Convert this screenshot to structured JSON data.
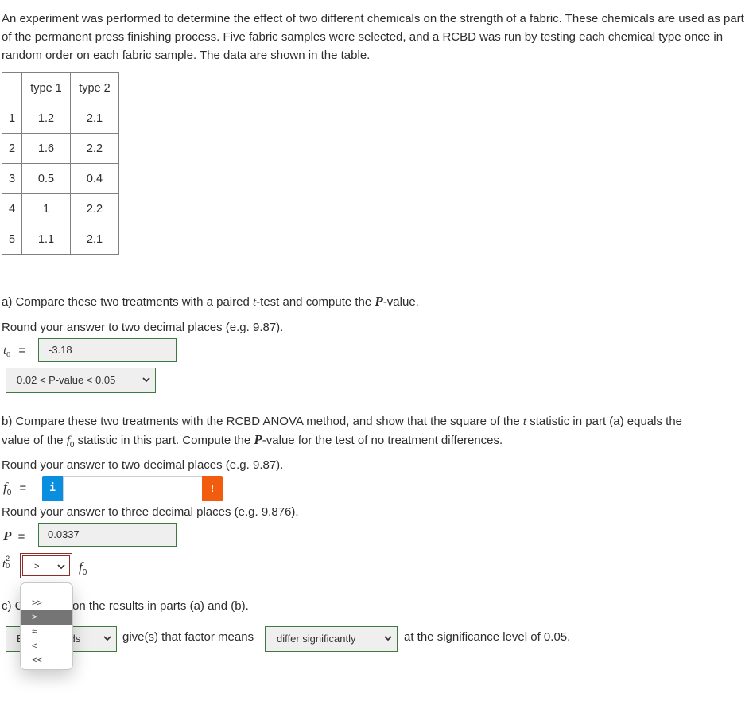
{
  "intro": "An experiment was performed to determine the effect of two different chemicals on the strength of a fabric. These chemicals are used as part of the permanent press finishing process. Five fabric samples were selected, and a RCBD was run by testing each chemical type once in random order on each fabric sample. The data are shown in the table.",
  "table": {
    "headers": [
      "",
      "type 1",
      "type 2"
    ],
    "rows": [
      [
        "1",
        "1.2",
        "2.1"
      ],
      [
        "2",
        "1.6",
        "2.2"
      ],
      [
        "3",
        "0.5",
        "0.4"
      ],
      [
        "4",
        "1",
        "2.2"
      ],
      [
        "5",
        "1.1",
        "2.1"
      ]
    ]
  },
  "part_a": {
    "q_pre": "a) Compare these two treatments with a paired ",
    "q_t": "t",
    "q_mid": "-test and compute the ",
    "q_P": "P",
    "q_post": "-value.",
    "round_note": "Round your answer to two decimal places (e.g. 9.87).",
    "t0_label": "t",
    "t0_sub": "0",
    "equals": "=",
    "t0_value": "-3.18",
    "pvalue_select": "0.02 < P-value < 0.05"
  },
  "part_b": {
    "q1_pre": "b) Compare these two treatments with the RCBD ANOVA method, and show that the square of the ",
    "q1_t": "t",
    "q1_post": " statistic in part (a) equals the",
    "q2_pre": "value of the ",
    "q2_f": "f",
    "q2_sub": "0",
    "q2_mid": " statistic in this part. Compute the ",
    "q2_P": "P",
    "q2_post": "-value for the test of no treatment differences.",
    "round_note_2": "Round your answer to two decimal places (e.g. 9.87).",
    "f0_label": "f",
    "f0_sub": "0",
    "equals": "=",
    "f0_value": "",
    "info_icon": "i",
    "error_icon": "!",
    "round_note_3": "Round your answer to three decimal places (e.g. 9.876).",
    "P_label": "P",
    "P_value": "0.0337",
    "compare_left": "t",
    "compare_left_sup": "2",
    "compare_left_sub": "0",
    "compare_select": ">",
    "compare_right": "f",
    "compare_right_sub": "0",
    "compare_options": [
      "",
      ">>",
      ">",
      "≈",
      "<",
      "<<"
    ],
    "compare_selected_index": 2
  },
  "part_c": {
    "q_pre": "c) C",
    "q_post": "on the results in parts (a) and (b).",
    "method_select": "Both methods",
    "mid_text": "give(s) that factor means",
    "conclusion_select": "differ significantly",
    "end_text": "at the significance level of 0.05."
  },
  "colors": {
    "input_border": "#3d7a3d",
    "input_bg": "#efefef",
    "info": "#0a8ee0",
    "error": "#f25c0e",
    "focus_border": "#8b2d2d",
    "selected_option": "#757575"
  }
}
